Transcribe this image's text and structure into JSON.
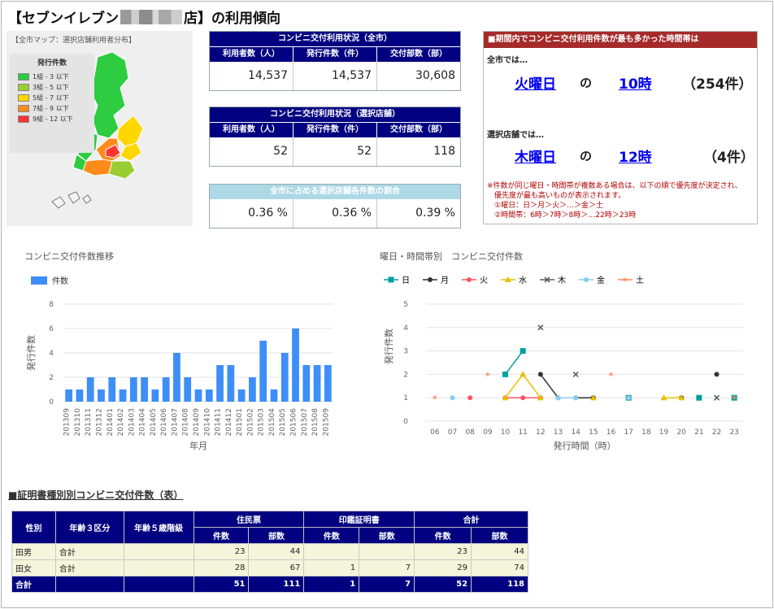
{
  "header": {
    "prefix": "【セブンイレブン",
    "suffix": "店】の利用傾向"
  },
  "map": {
    "caption": "【全市マップ：選択店舗利用者分布】",
    "legend_title": "発行件数",
    "legend": [
      {
        "label": "1組 - 3 以下",
        "color": "#2ecc40"
      },
      {
        "label": "3組 - 5 以下",
        "color": "#9acd32"
      },
      {
        "label": "5組 - 7 以下",
        "color": "#ffd700"
      },
      {
        "label": "7組 - 9 以下",
        "color": "#ff8c1a"
      },
      {
        "label": "9組 - 12 以下",
        "color": "#ff3333"
      }
    ]
  },
  "stats_all": {
    "title": "コンビニ交付利用状況（全市）",
    "columns": [
      "利用者数（人）",
      "発行件数（件）",
      "交付部数（部）"
    ],
    "values": [
      "14,537",
      "14,537",
      "30,608"
    ]
  },
  "stats_store": {
    "title": "コンビニ交付利用状況（選択店舗）",
    "columns": [
      "利用者数（人）",
      "発行件数（件）",
      "交付部数（部）"
    ],
    "values": [
      "52",
      "52",
      "118"
    ]
  },
  "stats_ratio": {
    "title": "全市に占める選択店舗各件数の割合",
    "values": [
      "0.36 %",
      "0.36 %",
      "0.39 %"
    ]
  },
  "peak": {
    "title": "■期間内でコンビニ交付利用件数が最も多かった時間帯は",
    "city_label": "全市では…",
    "city_day": "火曜日",
    "connector": "の",
    "city_hour": "10時",
    "city_count": "（254件）",
    "store_label": "選択店舗では…",
    "store_day": "木曜日",
    "store_hour": "12時",
    "store_count": "（4件）",
    "notes": [
      "※件数が同じ曜日・時間帯が複数ある場合は、以下の順で優先度が決定され、",
      "　優先度が最も高いものが表示されます。",
      "　①曜日：日＞月＞火＞…＞金＞土",
      "　②時間帯：6時＞7時＞8時＞…22時＞23時"
    ]
  },
  "colors": {
    "navy": "#000080",
    "bar": "#3e8ef7",
    "peak_header": "#a52a2a"
  },
  "chart_data": [
    {
      "type": "bar",
      "title": "コンビニ交付件数推移",
      "legend": [
        "件数"
      ],
      "xlabel": "年月",
      "ylabel": "発行件数",
      "ylim": [
        0,
        8
      ],
      "yticks": [
        0,
        2,
        4,
        6,
        8
      ],
      "grid": true,
      "categories": [
        "201309",
        "201310",
        "201311",
        "201312",
        "201401",
        "201402",
        "201403",
        "201404",
        "201405",
        "201406",
        "201407",
        "201408",
        "201409",
        "201410",
        "201411",
        "201412",
        "201501",
        "201502",
        "201503",
        "201504",
        "201505",
        "201506",
        "201507",
        "201508",
        "201509"
      ],
      "values": [
        1,
        1,
        2,
        1,
        2,
        1,
        2,
        2,
        1,
        2,
        4,
        2,
        1,
        1,
        3,
        3,
        1,
        2,
        5,
        1,
        4,
        6,
        3,
        3,
        3
      ]
    },
    {
      "type": "line",
      "title": "曜日・時間帯別　コンビニ交付件数",
      "xlabel": "発行時間（時）",
      "ylabel": "発行件数",
      "ylim": [
        0,
        5
      ],
      "yticks": [
        0,
        1,
        2,
        3,
        4,
        5
      ],
      "grid": true,
      "x": [
        "06",
        "07",
        "08",
        "09",
        "10",
        "11",
        "12",
        "13",
        "14",
        "15",
        "16",
        "17",
        "18",
        "19",
        "20",
        "21",
        "22",
        "23"
      ],
      "series": [
        {
          "name": "日",
          "color": "#00a0a0",
          "marker": "square",
          "values": [
            null,
            null,
            null,
            null,
            2,
            3,
            null,
            null,
            null,
            null,
            null,
            1,
            null,
            null,
            null,
            1,
            null,
            1
          ]
        },
        {
          "name": "月",
          "color": "#333333",
          "marker": "circle",
          "values": [
            null,
            null,
            null,
            null,
            null,
            null,
            2,
            1,
            1,
            1,
            null,
            null,
            null,
            null,
            1,
            null,
            2,
            null
          ]
        },
        {
          "name": "火",
          "color": "#ff5566",
          "marker": "circle",
          "values": [
            null,
            null,
            1,
            null,
            1,
            1,
            1,
            null,
            null,
            null,
            null,
            1,
            null,
            null,
            null,
            null,
            null,
            null
          ]
        },
        {
          "name": "水",
          "color": "#e8c000",
          "marker": "triangle",
          "values": [
            null,
            null,
            null,
            null,
            1,
            2,
            1,
            null,
            null,
            1,
            null,
            null,
            null,
            1,
            1,
            null,
            null,
            null
          ]
        },
        {
          "name": "木",
          "color": "#556060",
          "marker": "x",
          "values": [
            null,
            null,
            null,
            null,
            null,
            null,
            4,
            null,
            2,
            null,
            null,
            null,
            null,
            null,
            null,
            null,
            1,
            null
          ]
        },
        {
          "name": "金",
          "color": "#88ccee",
          "marker": "circle",
          "values": [
            null,
            1,
            null,
            null,
            null,
            null,
            null,
            1,
            1,
            null,
            null,
            1,
            null,
            null,
            null,
            null,
            null,
            null
          ]
        },
        {
          "name": "土",
          "color": "#ff8860",
          "marker": "star",
          "values": [
            1,
            null,
            null,
            2,
            null,
            null,
            null,
            null,
            null,
            null,
            2,
            null,
            null,
            null,
            null,
            null,
            null,
            1
          ]
        }
      ]
    }
  ],
  "cert_table": {
    "section_title": "■証明書種別別コンビニ交付件数（表）",
    "headers": {
      "gender": "性別",
      "age3": "年齢３区分",
      "age5": "年齢５歳階級",
      "groups": [
        "住民票",
        "印鑑証明書",
        "合計"
      ],
      "sub": [
        "件数",
        "部数"
      ]
    },
    "rows": [
      {
        "gender": "田男",
        "age3": "合計",
        "age5": "",
        "cells": [
          "23",
          "44",
          "",
          "",
          "23",
          "44"
        ]
      },
      {
        "gender": "田女",
        "age3": "合計",
        "age5": "",
        "cells": [
          "28",
          "67",
          "1",
          "7",
          "29",
          "74"
        ]
      }
    ],
    "total": {
      "label": "合計",
      "cells": [
        "51",
        "111",
        "1",
        "7",
        "52",
        "118"
      ]
    }
  }
}
